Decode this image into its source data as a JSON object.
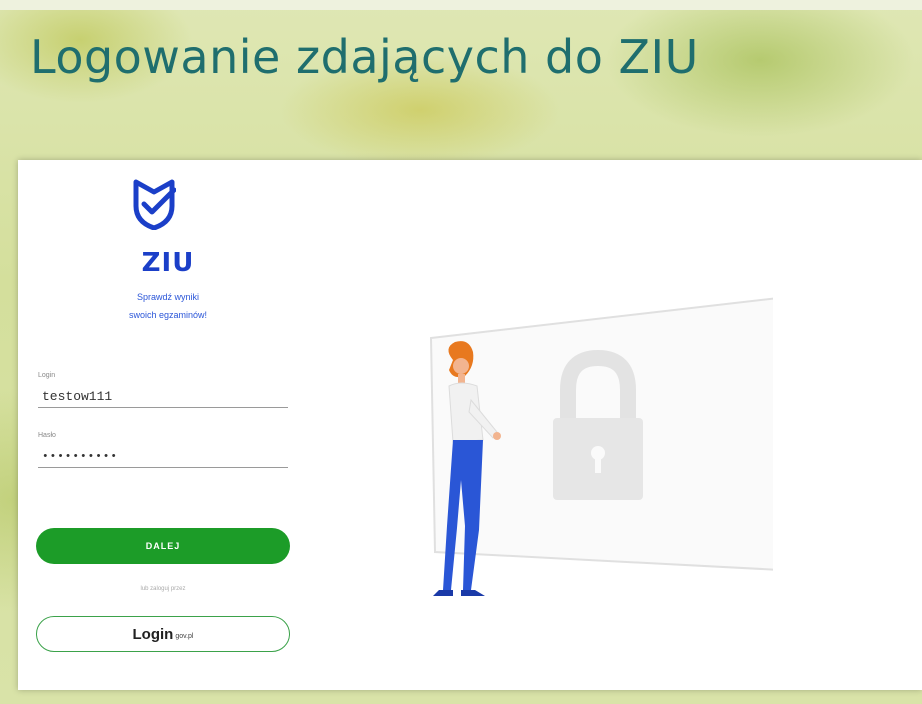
{
  "slide": {
    "title": "Logowanie zdających do ZIU"
  },
  "brand": {
    "name": "ZIU",
    "tagline_line1": "Sprawdź wyniki",
    "tagline_line2": "swoich egzaminów!",
    "color": "#1b3fc8"
  },
  "form": {
    "login_label": "Login",
    "login_value": "testow111",
    "password_label": "Hasło",
    "password_value": "••••••••••"
  },
  "buttons": {
    "next_label": "DALEJ",
    "alt_text": "lub zaloguj przez",
    "logingov_main": "Login",
    "logingov_sub": "gov.pl"
  },
  "colors": {
    "primary_button": "#1c9c28",
    "title": "#1f6e6e"
  },
  "icons": {
    "logo": "shield-check-icon",
    "illustration": "padlock-person-illustration"
  }
}
